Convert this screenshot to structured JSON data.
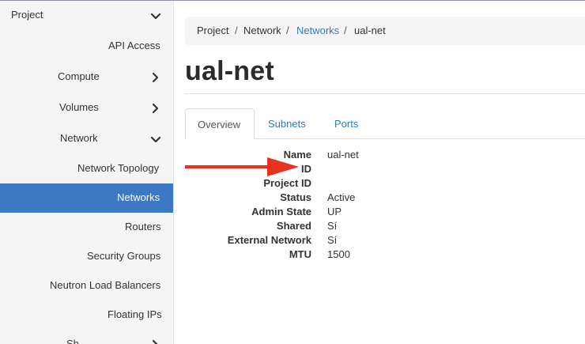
{
  "sidebar": {
    "project": "Project",
    "api_access": "API Access",
    "compute": "Compute",
    "volumes": "Volumes",
    "network": "Network",
    "network_topology": "Network Topology",
    "networks": "Networks",
    "routers": "Routers",
    "security_groups": "Security Groups",
    "neutron_lb": "Neutron Load Balancers",
    "floating_ips": "Floating IPs",
    "next_section": "Sh"
  },
  "breadcrumb": {
    "project": "Project",
    "network": "Network",
    "networks": "Networks",
    "current": "ual-net",
    "separator": "/"
  },
  "page_title": "ual-net",
  "tabs": [
    "Overview",
    "Subnets",
    "Ports"
  ],
  "details": [
    {
      "term": "Name",
      "value": "ual-net"
    },
    {
      "term": "ID",
      "value": ""
    },
    {
      "term": "Project ID",
      "value": ""
    },
    {
      "term": "Status",
      "value": "Active"
    },
    {
      "term": "Admin State",
      "value": "UP"
    },
    {
      "term": "Shared",
      "value": "Sí"
    },
    {
      "term": "External Network",
      "value": "Sí"
    },
    {
      "term": "MTU",
      "value": "1500"
    }
  ],
  "colors": {
    "active_nav": "#3c78c3",
    "link": "#337ab7",
    "annotation_arrow": "#e8321e"
  },
  "icons": {
    "expanded": "chevron-down-icon",
    "collapsed": "chevron-right-icon",
    "annotation": "red-arrow-annotation"
  }
}
